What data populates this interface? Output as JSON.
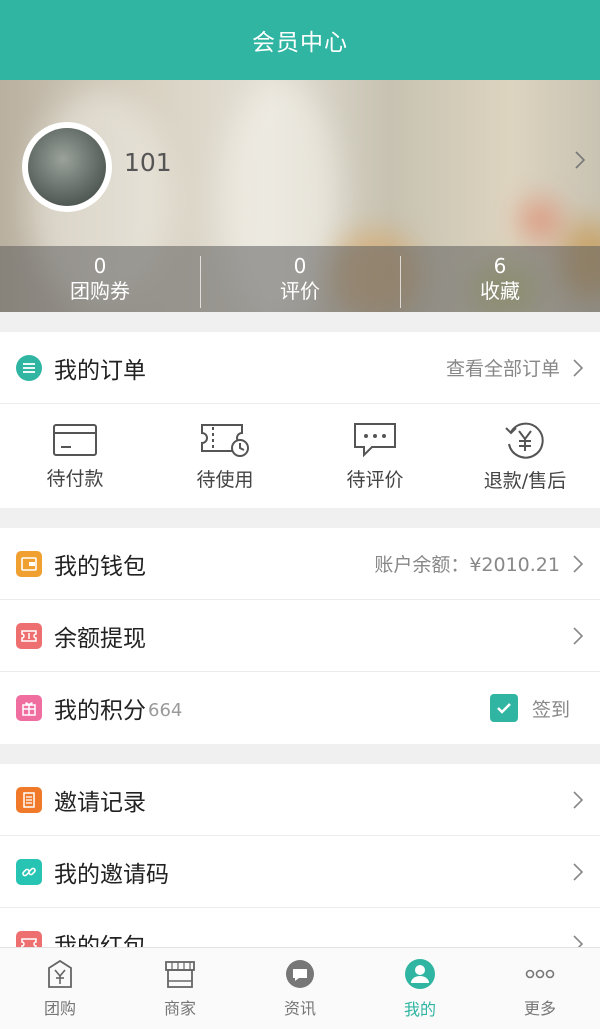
{
  "header": {
    "title": "会员中心"
  },
  "profile": {
    "username": "101"
  },
  "stats": [
    {
      "value": "0",
      "label": "团购券"
    },
    {
      "value": "0",
      "label": "评价"
    },
    {
      "value": "6",
      "label": "收藏"
    }
  ],
  "orders": {
    "title": "我的订单",
    "view_all": "查看全部订单",
    "items": [
      {
        "label": "待付款",
        "icon": "card-icon"
      },
      {
        "label": "待使用",
        "icon": "ticket-clock-icon"
      },
      {
        "label": "待评价",
        "icon": "chat-bubble-icon"
      },
      {
        "label": "退款/售后",
        "icon": "refund-yen-icon"
      }
    ]
  },
  "wallet": {
    "title": "我的钱包",
    "balance": "账户余额：¥2010.21",
    "icon_color": "#f0a030"
  },
  "withdraw": {
    "title": "余额提现",
    "icon_color": "#ee6f70"
  },
  "points": {
    "title": "我的积分",
    "value": "664",
    "checkin_label": "签到",
    "icon_color": "#f06da0"
  },
  "invite_records": {
    "title": "邀请记录",
    "icon_color": "#f07a2a"
  },
  "invite_code": {
    "title": "我的邀请码",
    "icon_color": "#27c4b4"
  },
  "red_packet": {
    "title": "我的红包",
    "icon_color": "#ee6f70"
  },
  "tabbar": [
    {
      "label": "团购",
      "icon": "shopping-bag-yen-icon",
      "active": false
    },
    {
      "label": "商家",
      "icon": "storefront-icon",
      "active": false
    },
    {
      "label": "资讯",
      "icon": "chat-bubble-icon",
      "active": false
    },
    {
      "label": "我的",
      "icon": "user-circle-icon",
      "active": true
    },
    {
      "label": "更多",
      "icon": "more-dots-icon",
      "active": false
    }
  ],
  "colors": {
    "accent": "#2fb5a2",
    "header_bg": "#2fb5a2"
  }
}
